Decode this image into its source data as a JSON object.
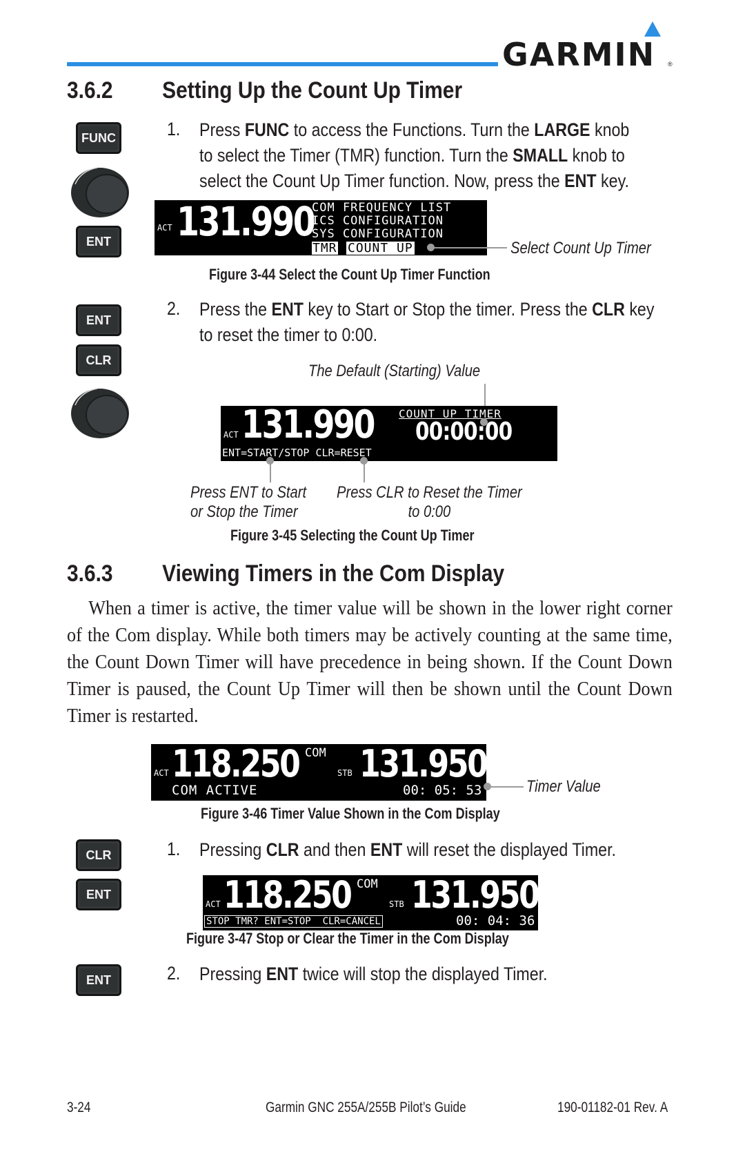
{
  "header": {
    "brand": "GARMIN",
    "brand_reg": "®",
    "accent_color": "#2b8fe3"
  },
  "section_362": {
    "number": "3.6.2",
    "title": "Setting Up the Count Up Timer",
    "step1": {
      "num": "1.",
      "line1": [
        "Press ",
        "FUNC",
        " to access the Functions. Turn the ",
        "LARGE",
        " knob"
      ],
      "line2": [
        "to select the Timer (TMR) function. Turn the ",
        "SMALL",
        " knob to"
      ],
      "line3": [
        "select the Count Up Timer function. Now, press the ",
        "ENT",
        " key."
      ]
    },
    "step2": {
      "num": "2.",
      "line1": [
        "Press the ",
        "ENT",
        " key to Start or Stop the timer. Press the ",
        "CLR",
        " key"
      ],
      "line2": "to reset the timer to 0:00."
    },
    "side_keys_step1": [
      "FUNC",
      "ENT"
    ],
    "side_keys_step2": [
      "ENT",
      "CLR"
    ],
    "figure_44": {
      "caption": "Figure 3-44  Select the Count Up Timer Function",
      "display": {
        "act_label": "ACT",
        "frequency": "131.990",
        "menu": [
          "COM FREQUENCY LIST",
          "ICS CONFIGURATION",
          "SYS CONFIGURATION"
        ],
        "selected_category": "TMR",
        "selected_item": "COUNT UP"
      },
      "annotation": "Select Count Up Timer"
    },
    "figure_45": {
      "caption": "Figure 3-45  Selecting the Count Up Timer",
      "display": {
        "act_label": "ACT",
        "frequency": "131.990",
        "timer_title": "COUNT UP TIMER",
        "timer_value": "00:00:00",
        "prompt": "ENT=START/STOP CLR=RESET"
      },
      "annotation_top": "The Default (Starting) Value",
      "annotation_left": [
        "Press ENT to Start",
        "or Stop the Timer"
      ],
      "annotation_right": [
        "Press CLR to Reset the Timer",
        "to 0:00"
      ]
    }
  },
  "section_363": {
    "number": "3.6.3",
    "title": "Viewing Timers in the Com Display",
    "paragraph": "When a timer is active, the timer value will be shown in the lower right corner of the Com display. While both timers may be actively counting at the same time, the Count Down Timer will have precedence in being shown. If the Count Down Timer is paused, the Count Up Timer will then be shown until the Count Down Timer is restarted.",
    "figure_46": {
      "caption": "Figure 3-46  Timer Value Shown in the Com Display",
      "display": {
        "act_label": "ACT",
        "active_freq": "118.250",
        "com_label": "COM",
        "stb_label": "STB",
        "standby_freq": "131.950",
        "status": "COM ACTIVE",
        "timer_value": "00: 05: 53"
      },
      "annotation": "Timer Value"
    },
    "step1": {
      "num": "1.",
      "text": [
        "Pressing ",
        "CLR",
        " and then ",
        "ENT",
        " will reset the displayed Timer."
      ]
    },
    "side_keys_step1": [
      "CLR",
      "ENT"
    ],
    "figure_47": {
      "caption": "Figure 3-47  Stop or Clear the Timer in the Com Display",
      "display": {
        "act_label": "ACT",
        "active_freq": "118.250",
        "com_label": "COM",
        "stb_label": "STB",
        "standby_freq": "131.950",
        "prompt": "STOP TMR? ENT=STOP  CLR=CANCEL",
        "timer_value": "00: 04: 36"
      }
    },
    "step2": {
      "num": "2.",
      "text": [
        "Pressing ",
        "ENT",
        " twice will stop the displayed Timer."
      ]
    },
    "side_keys_step2": [
      "ENT"
    ]
  },
  "footer": {
    "page": "3-24",
    "title": "Garmin GNC 255A/255B Pilot’s Guide",
    "doc_number": "190-01182-01  Rev. A"
  }
}
